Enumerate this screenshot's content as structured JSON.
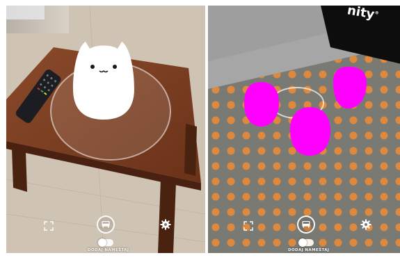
{
  "screens": [
    {
      "id": "camera-view",
      "toggle_label": "DODAJ NAMEŠTAJ",
      "toggle_on": false,
      "icons": {
        "left": "fullscreen-icon",
        "center": "furniture-icon",
        "right": "gear-icon"
      }
    },
    {
      "id": "editor-view",
      "toggle_label": "DODAJ NAMEŠTAJ",
      "toggle_on": false,
      "logo_text": "nity",
      "logo_mark": "®",
      "icons": {
        "left": "fullscreen-icon",
        "center": "furniture-icon",
        "right": "gear-icon"
      }
    }
  ],
  "colors": {
    "model_camera": "#ffffff",
    "model_editor": "#ff00ff",
    "floor_editor": "#7a7a74",
    "dots_editor": "#e38a3a",
    "table_wood": "#7a3c1f",
    "floor_wood": "#cbbfae"
  }
}
